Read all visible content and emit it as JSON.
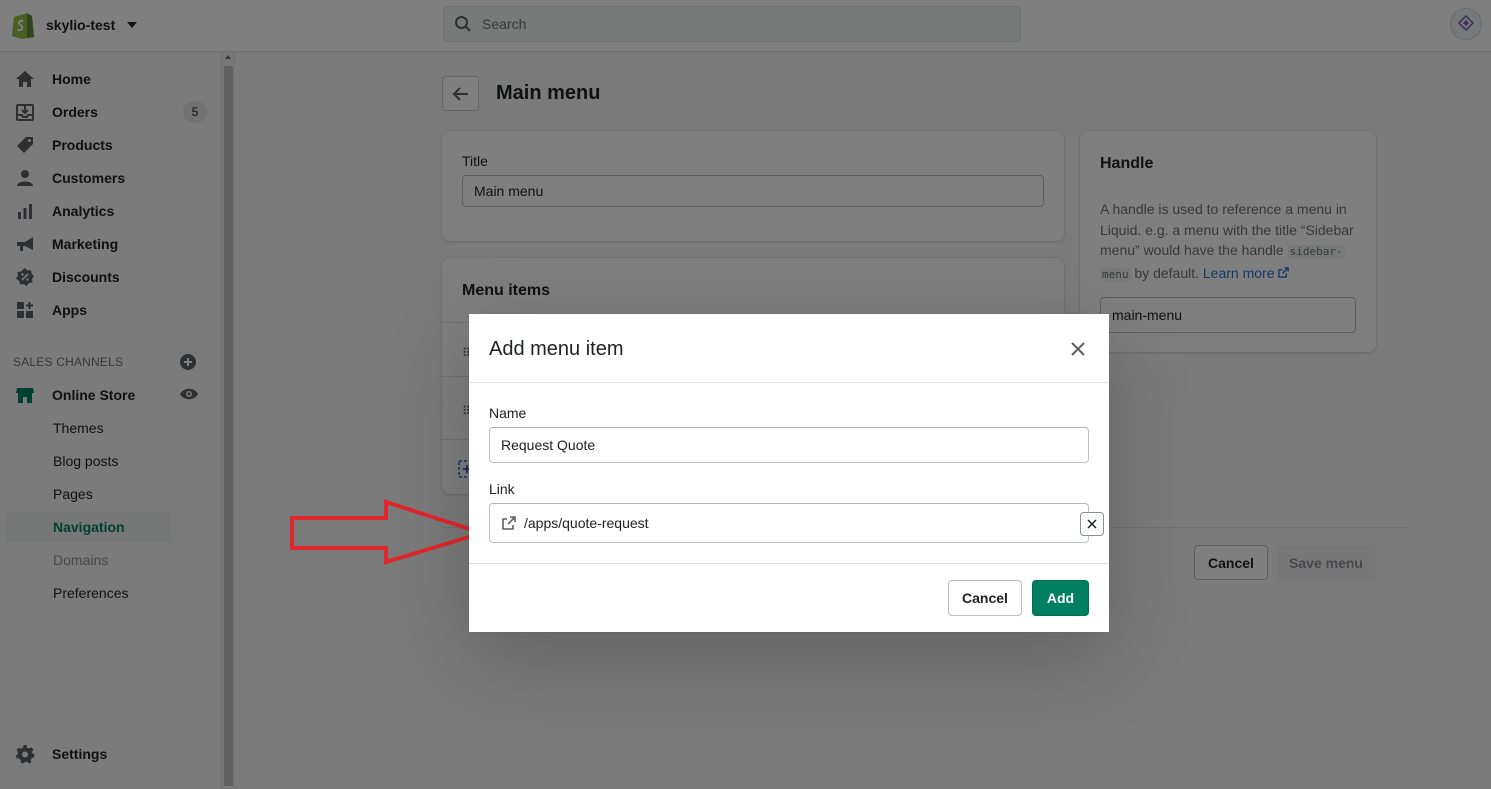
{
  "topbar": {
    "store_name": "skylio-test",
    "search_placeholder": "Search"
  },
  "sidebar": {
    "items": [
      {
        "label": "Home",
        "icon": "home-icon"
      },
      {
        "label": "Orders",
        "icon": "orders-icon",
        "badge": "5"
      },
      {
        "label": "Products",
        "icon": "tag-icon"
      },
      {
        "label": "Customers",
        "icon": "person-icon"
      },
      {
        "label": "Analytics",
        "icon": "bar-chart-icon"
      },
      {
        "label": "Marketing",
        "icon": "megaphone-icon"
      },
      {
        "label": "Discounts",
        "icon": "discount-icon"
      },
      {
        "label": "Apps",
        "icon": "apps-icon"
      }
    ],
    "sales_channels_title": "SALES CHANNELS",
    "online_store": "Online Store",
    "sub_items": [
      "Themes",
      "Blog posts",
      "Pages",
      "Navigation",
      "Domains",
      "Preferences"
    ],
    "settings": "Settings"
  },
  "page": {
    "title": "Main menu",
    "title_field_label": "Title",
    "title_field_value": "Main menu",
    "menu_items_heading": "Menu items",
    "handle_heading": "Handle",
    "handle_help_1": "A handle is used to reference a menu in Liquid. e.g. a menu with the title “Sidebar menu” would have the handle",
    "handle_code_1": "sidebar-",
    "handle_code_2": "menu",
    "handle_help_2": "by default.",
    "learn_more": "Learn more",
    "handle_value": "main-menu",
    "cancel_label": "Cancel",
    "save_label": "Save menu"
  },
  "modal": {
    "title": "Add menu item",
    "name_label": "Name",
    "name_value": "Request Quote",
    "link_label": "Link",
    "link_value": "/apps/quote-request",
    "cancel_label": "Cancel",
    "add_label": "Add"
  },
  "colors": {
    "primary": "#008060",
    "link": "#2c6ecb",
    "arrow": "#e0282d"
  }
}
